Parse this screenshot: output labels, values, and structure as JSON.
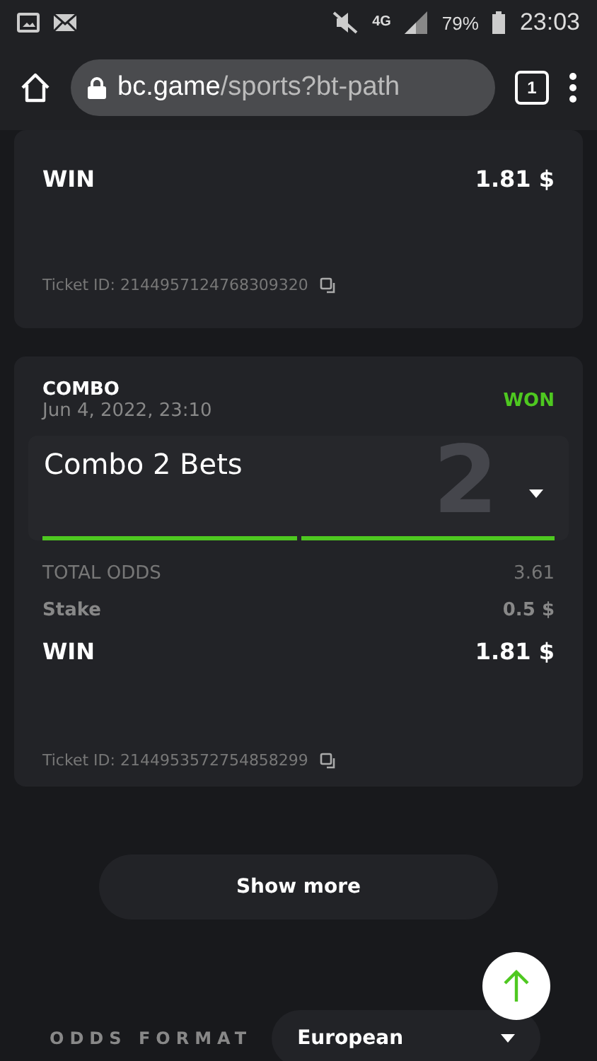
{
  "status_bar": {
    "network": "4G",
    "battery": "79%",
    "time": "23:03"
  },
  "browser": {
    "url_host": "bc.game",
    "url_path": "/sports?bt-path",
    "tab_count": "1"
  },
  "tickets": [
    {
      "kind": "partial",
      "rows": [
        {
          "label": "WIN",
          "value": "1.81 $",
          "kind": "win"
        }
      ],
      "ticket_id": "Ticket ID: 2144957124768309320"
    },
    {
      "kind": "full",
      "type": "COMBO",
      "date": "Jun 4, 2022, 23:10",
      "status": "WON",
      "combo": {
        "title": "Combo 2 Bets",
        "big_number": "2",
        "legs": [
          {
            "won": true
          },
          {
            "won": true
          }
        ]
      },
      "rows": [
        {
          "label": "TOTAL ODDS",
          "value": "3.61",
          "kind": "odds"
        },
        {
          "label": "Stake",
          "value": "0.5 $",
          "kind": "stake"
        },
        {
          "label": "WIN",
          "value": "1.81 $",
          "kind": "win"
        }
      ],
      "ticket_id": "Ticket ID: 2144953572754858299"
    }
  ],
  "show_more": "Show more",
  "odds_format": {
    "label": "ODDS FORMAT",
    "value": "European"
  }
}
